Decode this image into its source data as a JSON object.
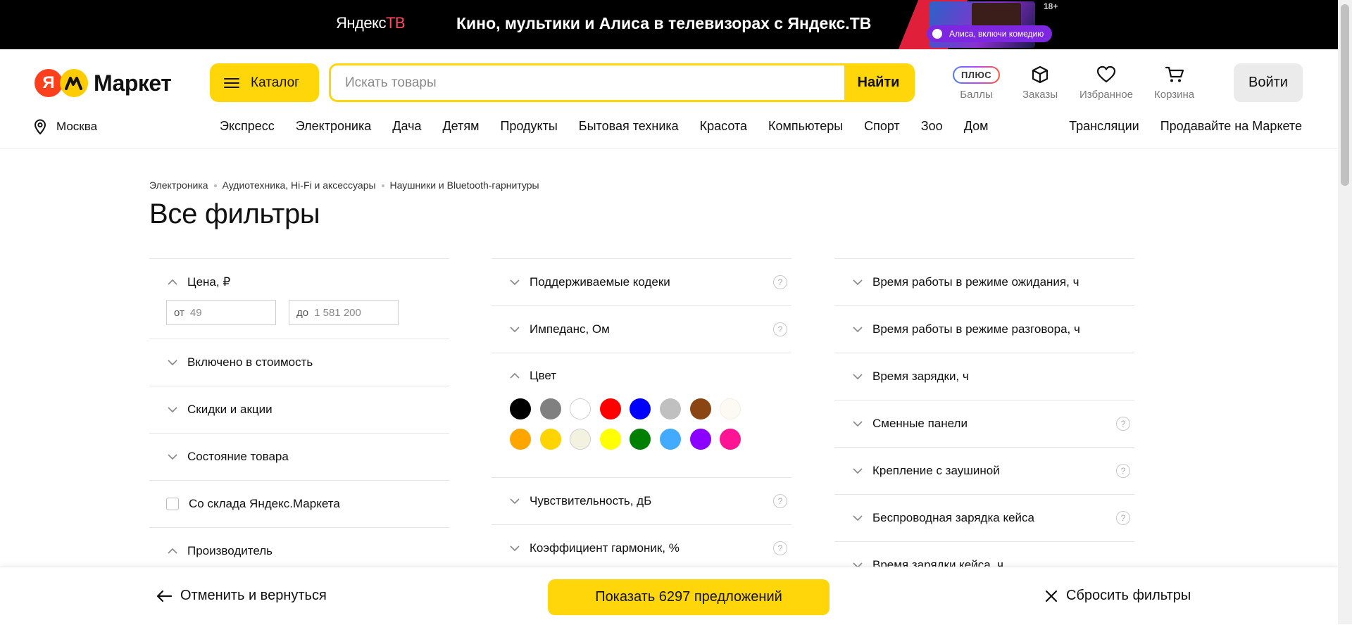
{
  "banner": {
    "logo_brand": "Яндекс",
    "logo_suffix": "ТВ",
    "promo_text": "Кино, мультики и Алиса в телевизорах с Яндекс.ТВ",
    "alisa_chip": "Алиса, включи комедию",
    "age_badge": "18+",
    "accent_color": "#e0203a"
  },
  "header": {
    "logo_letter": "Я",
    "logo_text": "Маркет",
    "catalog_label": "Каталог",
    "search_placeholder": "Искать товары",
    "search_value": "",
    "search_button": "Найти",
    "plus_badge": "ПЛЮС",
    "items": [
      {
        "label": "Баллы",
        "icon": "plus-points-icon"
      },
      {
        "label": "Заказы",
        "icon": "box-icon"
      },
      {
        "label": "Избранное",
        "icon": "heart-icon"
      },
      {
        "label": "Корзина",
        "icon": "cart-icon"
      }
    ],
    "login_label": "Войти",
    "city": "Москва",
    "nav": [
      "Экспресс",
      "Электроника",
      "Дача",
      "Детям",
      "Продукты",
      "Бытовая техника",
      "Красота",
      "Компьютеры",
      "Спорт",
      "Зоо",
      "Дом"
    ],
    "nav_right": [
      "Трансляции",
      "Продавайте на Маркете"
    ],
    "brand_yellow": "#ffd60a"
  },
  "breadcrumb": [
    "Электроника",
    "Аудиотехника, Hi-Fi и аксессуары",
    "Наушники и Bluetooth-гарнитуры"
  ],
  "page_title": "Все фильтры",
  "filters": {
    "col1": {
      "price_label": "Цена, ₽",
      "price_from_prefix": "от",
      "price_from_placeholder": "49",
      "price_to_prefix": "до",
      "price_to_placeholder": "1 581 200",
      "included": "Включено в стоимость",
      "discounts": "Скидки и акции",
      "condition": "Состояние товара",
      "warehouse": "Со склада Яндекс.Маркета",
      "manufacturer": "Производитель"
    },
    "col2": {
      "codecs": "Поддерживаемые кодеки",
      "impedance": "Импеданс, Ом",
      "color_label": "Цвет",
      "color_swatches": [
        "#000000",
        "#808080",
        "#ffffff",
        "#ff0000",
        "#0000ff",
        "#c0c0c0",
        "#8b4513",
        "#fdfaf3",
        "#ffa500",
        "#ffd400",
        "#f3f2e1",
        "#ffff00",
        "#008000",
        "#42aaff",
        "#8b00ff",
        "#ff1493"
      ],
      "sensitivity": "Чувствительность, дБ",
      "harmonic": "Коэффициент гармоник, %"
    },
    "col3": {
      "standby": "Время работы в режиме ожидания, ч",
      "talk": "Время работы в режиме разговора, ч",
      "charge": "Время зарядки, ч",
      "panels": "Сменные панели",
      "earhook": "Крепление с заушиной",
      "wireless_case": "Беспроводная зарядка кейса",
      "case_charge": "Время зарядки кейса, ч"
    },
    "help_glyph": "?"
  },
  "bottom": {
    "cancel": "Отменить и вернуться",
    "show": "Показать 6297 предложений",
    "reset": "Сбросить фильтры"
  }
}
